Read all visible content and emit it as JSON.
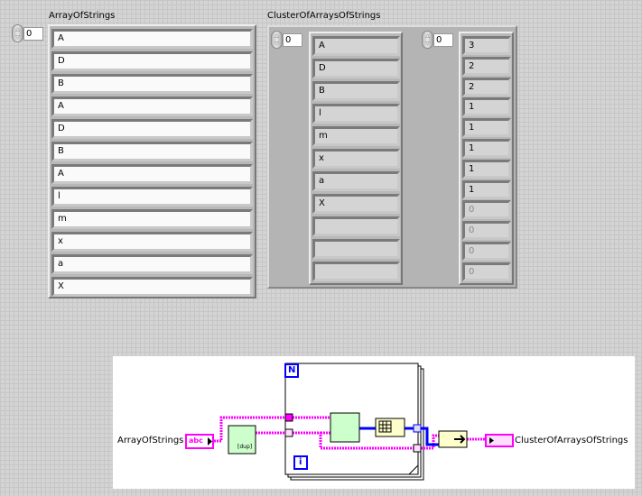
{
  "front_panel": {
    "array_of_strings": {
      "label": "ArrayOfStrings",
      "index": "0",
      "values": [
        "A",
        "D",
        "B",
        "A",
        "D",
        "B",
        "A",
        "l",
        "m",
        "x",
        "a",
        "X"
      ]
    },
    "cluster_of_arrays_of_strings": {
      "label": "ClusterOfArraysOfStrings",
      "strings_array": {
        "index": "0",
        "values": [
          "A",
          "D",
          "B",
          "l",
          "m",
          "x",
          "a",
          "X",
          "",
          "",
          ""
        ]
      },
      "counts_array": {
        "index": "0",
        "values": [
          "3",
          "2",
          "2",
          "1",
          "1",
          "1",
          "1",
          "1",
          "0",
          "0",
          "0",
          "0"
        ],
        "default_count": 4
      }
    }
  },
  "block_diagram": {
    "input_terminal_label": "ArrayOfStrings",
    "input_terminal_glyph": "abc",
    "output_terminal_label": "ClusterOfArraysOfStrings",
    "loop_count_label": "N",
    "loop_index_label": "i",
    "duplicate_node_label": "[dup]",
    "wire_colors": {
      "string": "#ff00ff",
      "numeric": "#0000ff"
    }
  }
}
